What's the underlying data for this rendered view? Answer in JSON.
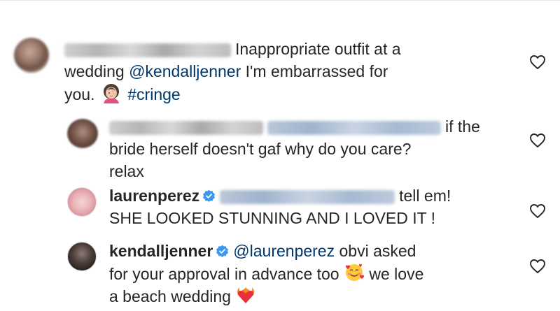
{
  "comments": [
    {
      "text": "Inappropriate outfit at a",
      "line2_mention": "@kendalljenner",
      "line2_text": " I'm embarrassed for",
      "line3_text": "you. ",
      "line3_hashtag": "#cringe"
    },
    {
      "text": "if the",
      "line2_text": "bride herself doesn't gaf why do you care?",
      "line3_text": "relax"
    },
    {
      "username": "laurenperez",
      "text": "tell em!",
      "line2_text": "SHE LOOKED STUNNING AND I LOVED IT !"
    },
    {
      "username": "kendalljenner",
      "mention": "@laurenperez",
      "text": " obvi asked",
      "line2_text": "for your approval in advance too ",
      "line2_after": " we love",
      "line3_text": "a beach wedding "
    }
  ],
  "icons": {
    "like": "heart-outline-icon",
    "verified": "verified-badge-icon",
    "emoji_woman_facepalm": "woman-facepalming-emoji",
    "emoji_smiling_hearts": "smiling-face-with-hearts-emoji",
    "emoji_heart_fire": "heart-on-fire-emoji"
  },
  "colors": {
    "link": "#00376b",
    "verified": "#3897f0",
    "text": "#262626"
  }
}
